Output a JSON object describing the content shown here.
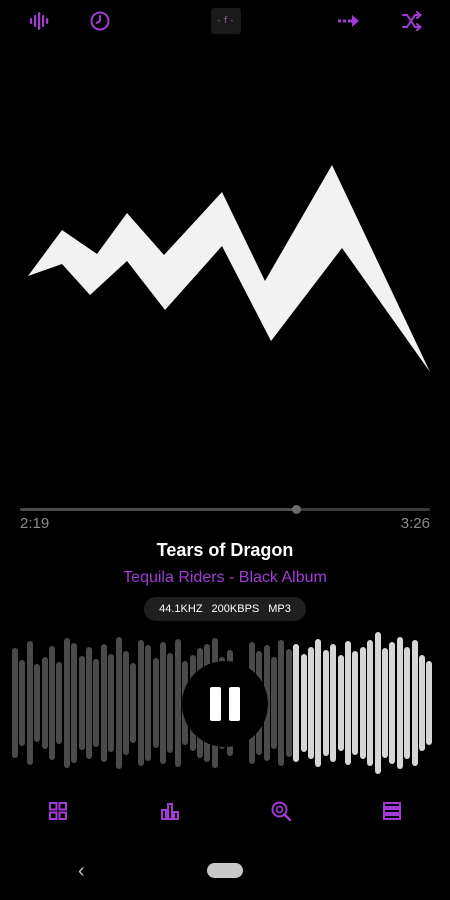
{
  "colors": {
    "accent": "#a23ad6",
    "background": "#000000",
    "played_bar": "#4a4a4a",
    "unplayed_bar": "#d6d6d6"
  },
  "toolbar": {
    "icons": [
      "equalizer-icon",
      "sleep-timer-icon",
      "app-logo",
      "repeat-icon",
      "shuffle-icon"
    ],
    "logo_text": "-f-"
  },
  "player": {
    "elapsed": "2:19",
    "duration": "3:26",
    "progress": 0.675,
    "track_title": "Tears of Dragon",
    "artist_album": "Tequila Riders - Black Album",
    "format": {
      "sample_rate": "44.1KHZ",
      "bitrate": "200KBPS",
      "codec": "MP3"
    },
    "state": "playing"
  },
  "bottom_nav": {
    "icons": [
      "library-grid-icon",
      "visualizer-chart-icon",
      "search-icon",
      "playlist-icon"
    ]
  },
  "system_nav": {
    "back_glyph": "‹"
  }
}
